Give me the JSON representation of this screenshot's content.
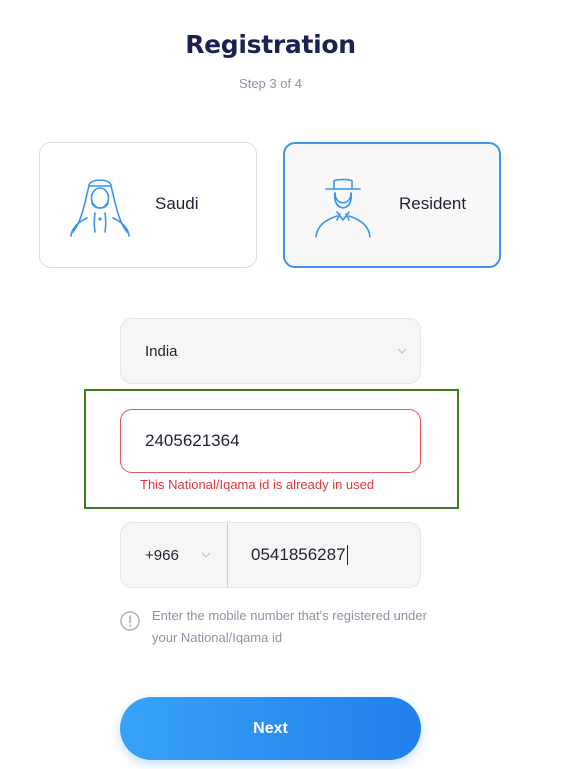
{
  "header": {
    "title": "Registration",
    "step": "Step 3 of 4"
  },
  "user_types": [
    {
      "label": "Saudi",
      "icon": "saudi-person-icon",
      "selected": false
    },
    {
      "label": "Resident",
      "icon": "resident-person-icon",
      "selected": true
    }
  ],
  "form": {
    "nationality": {
      "value": "India"
    },
    "national_id": {
      "value": "2405621364",
      "error": "This National/Iqama id is already in used"
    },
    "mobile": {
      "country_code": "+966",
      "value": "0541856287"
    },
    "hint": "Enter the mobile number that's registered under your National/Iqama id"
  },
  "actions": {
    "next_label": "Next"
  },
  "colors": {
    "accent": "#3a95f0",
    "title": "#1b2252",
    "error": "#d9393e",
    "highlight": "#3f7a1c"
  }
}
